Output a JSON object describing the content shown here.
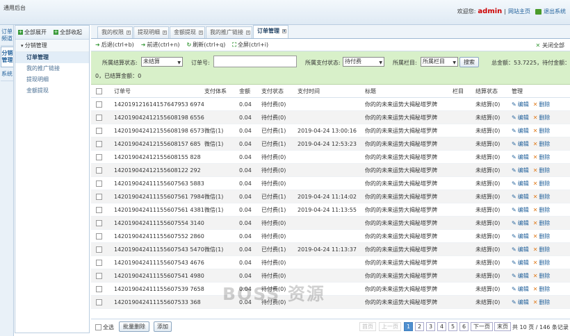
{
  "app_title": "通用后台",
  "header": {
    "welcome": "欢迎您:",
    "username": "admin",
    "divider": "|",
    "site_home": "网站主页",
    "logout": "退出系统"
  },
  "vtabs": [
    "订单频道",
    "分销管理",
    "系统"
  ],
  "sidebar": {
    "expand_all": "全部展开",
    "collapse_all": "全部收起",
    "group": "分销管理",
    "items": [
      "订单管理",
      "我的推广链接",
      "提现明细",
      "金额提现"
    ],
    "active_index": 0
  },
  "tabs": [
    "我的权限",
    "提现明细",
    "金额提现",
    "我的推广链接",
    "订单管理"
  ],
  "active_tab": 4,
  "toolbar": {
    "back": "后退(ctrl+b)",
    "forward": "前进(ctrl+n)",
    "refresh": "刷新(ctrl+q)",
    "fullscreen": "全屏(ctrl+i)",
    "close_all": "关闭全部"
  },
  "filter": {
    "settle_label": "所属结算状态:",
    "settle_value": "未结算",
    "order_label": "订单号:",
    "order_value": "",
    "pay_label": "所属支付状态:",
    "pay_value": "待付费",
    "column_label": "所属栏目:",
    "column_value": "所属栏目",
    "search": "搜索",
    "total": "总金额：53.7225，待付金额：",
    "settled": "0，已结算金额：0"
  },
  "table": {
    "headers": [
      "订单号",
      "支付体系",
      "金额",
      "支付状态",
      "支付时间",
      "标题",
      "栏目",
      "结算状态",
      "管理"
    ],
    "edit": "编辑",
    "delete": "删除",
    "rows": [
      [
        "142019121614157647953 6974",
        "",
        "0.04",
        "待付费(0)",
        "",
        "你的的未来运势大揭秘塔罗牌",
        "",
        "未结算(0)"
      ],
      [
        "142019042412155608198 6556",
        "",
        "0.04",
        "待付费(0)",
        "",
        "你的的未来运势大揭秘塔罗牌",
        "",
        "未结算(0)"
      ],
      [
        "142019042412155608198 6573",
        "微信(1)",
        "0.04",
        "已付费(1)",
        "2019-04-24 13:00:16",
        "你的的未来运势大揭秘塔罗牌",
        "",
        "未结算(0)"
      ],
      [
        "142019042412155608157 685",
        "微信(1)",
        "0.04",
        "已付费(1)",
        "2019-04-24 12:53:23",
        "你的的未来运势大揭秘塔罗牌",
        "",
        "未结算(0)"
      ],
      [
        "142019042412155608155 828",
        "",
        "0.04",
        "待付费(0)",
        "",
        "你的的未来运势大揭秘塔罗牌",
        "",
        "未结算(0)"
      ],
      [
        "142019042412155608122 292",
        "",
        "0.04",
        "待付费(0)",
        "",
        "你的的未来运势大揭秘塔罗牌",
        "",
        "未结算(0)"
      ],
      [
        "142019042411155607563 5883",
        "",
        "0.04",
        "待付费(0)",
        "",
        "你的的未来运势大揭秘塔罗牌",
        "",
        "未结算(0)"
      ],
      [
        "142019042411155607561 7984",
        "微信(1)",
        "0.04",
        "已付费(1)",
        "2019-04-24 11:14:02",
        "你的的未来运势大揭秘塔罗牌",
        "",
        "未结算(0)"
      ],
      [
        "142019042411155607561 4381",
        "微信(1)",
        "0.04",
        "已付费(1)",
        "2019-04-24 11:13:55",
        "你的的未来运势大揭秘塔罗牌",
        "",
        "未结算(0)"
      ],
      [
        "142019042411155607554 3140",
        "",
        "0.04",
        "待付费(0)",
        "",
        "你的的未来运势大揭秘塔罗牌",
        "",
        "未结算(0)"
      ],
      [
        "142019042411155607552 2860",
        "",
        "0.04",
        "待付费(0)",
        "",
        "你的的未来运势大揭秘塔罗牌",
        "",
        "未结算(0)"
      ],
      [
        "142019042411155607543 5470",
        "微信(1)",
        "0.04",
        "已付费(1)",
        "2019-04-24 11:13:37",
        "你的的未来运势大揭秘塔罗牌",
        "",
        "未结算(0)"
      ],
      [
        "142019042411155607543 4676",
        "",
        "0.04",
        "待付费(0)",
        "",
        "你的的未来运势大揭秘塔罗牌",
        "",
        "未结算(0)"
      ],
      [
        "142019042411155607541 4980",
        "",
        "0.04",
        "待付费(0)",
        "",
        "你的的未来运势大揭秘塔罗牌",
        "",
        "未结算(0)"
      ],
      [
        "142019042411155607539 7658",
        "",
        "0.04",
        "待付费(0)",
        "",
        "你的的未来运势大揭秘塔罗牌",
        "",
        "未结算(0)"
      ],
      [
        "142019042411155607533 368",
        "",
        "0.04",
        "待付费(0)",
        "",
        "你的的未来运势大揭秘塔罗牌",
        "",
        "未结算(0)"
      ]
    ]
  },
  "footer": {
    "select_all": "全选",
    "batch_delete": "批量删除",
    "add": "添加",
    "first": "首页",
    "prev": "上一页",
    "pages": [
      "1",
      "2",
      "3",
      "4",
      "5",
      "6"
    ],
    "current_page": "1",
    "next": "下一页",
    "last": "末页",
    "summary": "共 10 页 / 146 条记录"
  },
  "watermark": "BOSS 资源",
  "colors": {
    "filter_bg": "#d8f0c9",
    "accent": "#4f8fcf",
    "username": "#cc0000"
  }
}
